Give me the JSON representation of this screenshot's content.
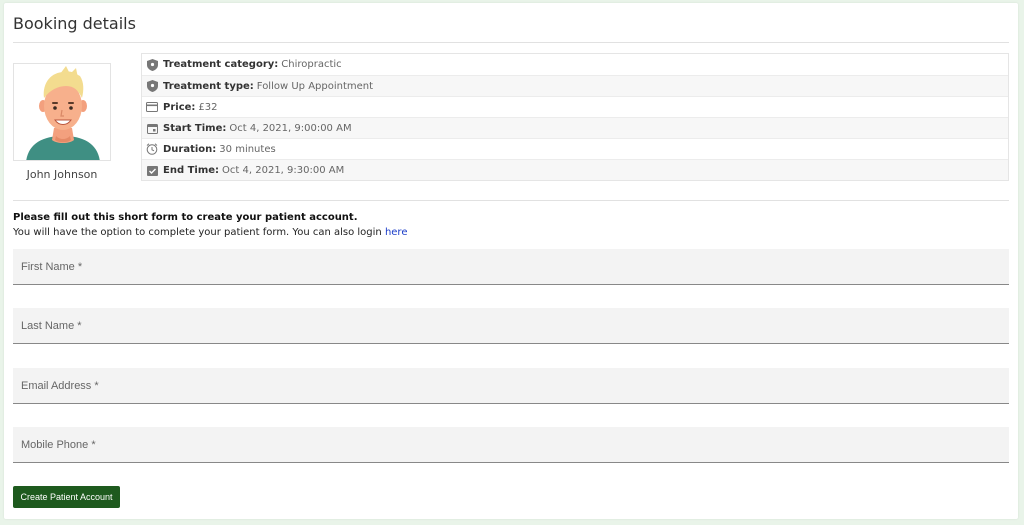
{
  "header": {
    "title": "Booking details"
  },
  "provider": {
    "name": "John Johnson",
    "avatar_icon": "person-avatar-icon"
  },
  "details": [
    {
      "icon": "shield-icon",
      "label": "Treatment category:",
      "value": "Chiropractic"
    },
    {
      "icon": "shield-icon",
      "label": "Treatment type:",
      "value": "Follow Up Appointment"
    },
    {
      "icon": "credit-card-icon",
      "label": "Price:",
      "value": "£32"
    },
    {
      "icon": "calendar-icon",
      "label": "Start Time:",
      "value": "Oct 4, 2021, 9:00:00 AM"
    },
    {
      "icon": "clock-icon",
      "label": "Duration:",
      "value": "30 minutes"
    },
    {
      "icon": "calendar-check-icon",
      "label": "End Time:",
      "value": "Oct 4, 2021, 9:30:00 AM"
    }
  ],
  "intro": {
    "heading": "Please fill out this short form to create your patient account.",
    "text": "You will have the option to complete your patient form. You can also login ",
    "link_text": "here"
  },
  "form": {
    "first_name": {
      "placeholder": "First Name *",
      "value": ""
    },
    "last_name": {
      "placeholder": "Last Name *",
      "value": ""
    },
    "email": {
      "placeholder": "Email Address *",
      "value": ""
    },
    "mobile": {
      "placeholder": "Mobile Phone *",
      "value": ""
    },
    "submit_label": "Create Patient Account"
  },
  "colors": {
    "page_background": "#e9f4e9",
    "button": "#1e5a1e",
    "link": "#1a3cc8",
    "field_background": "#f3f3f3"
  }
}
